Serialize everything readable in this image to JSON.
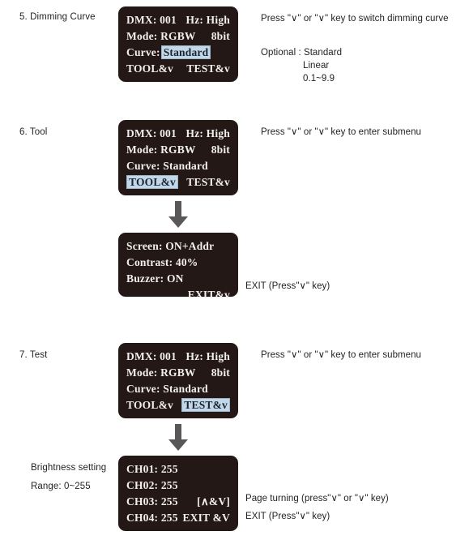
{
  "sections": [
    {
      "id": "dimming-curve",
      "label": "5. Dimming Curve",
      "lcd": {
        "row1_left": "DMX: 001",
        "row1_right": "Hz: High",
        "row2_left": "Mode: RGBW",
        "row2_right": "8bit",
        "row3_label": "Curve:",
        "row3_value": "Standard",
        "row4_left": "TOOL&v",
        "row4_right": "TEST&v"
      },
      "notes": {
        "instruction": "Press \"∨\" or \"∨\" key to switch dimming curve",
        "optional_label": "Optional : Standard",
        "optional_items": [
          "Linear",
          "0.1~9.9"
        ]
      }
    },
    {
      "id": "tool",
      "label": "6. Tool",
      "lcd": {
        "row1_left": "DMX: 001",
        "row1_right": "Hz: High",
        "row2_left": "Mode: RGBW",
        "row2_right": "8bit",
        "row3_left": "Curve: Standard",
        "row4_left": "TOOL&v",
        "row4_right": "TEST&v"
      },
      "notes": {
        "instruction": "Press \"∨\" or \"∨\" key to enter submenu"
      },
      "submenu": {
        "row1": "Screen: ON+Addr",
        "row2": "Contrast: 40%",
        "row3": "Buzzer: ON",
        "row4": "EXIT&v",
        "note": "EXIT (Press\"∨\" key)"
      }
    },
    {
      "id": "test",
      "label": "7. Test",
      "lcd": {
        "row1_left": "DMX: 001",
        "row1_right": "Hz: High",
        "row2_left": "Mode: RGBW",
        "row2_right": "8bit",
        "row3_left": "Curve: Standard",
        "row4_left": "TOOL&v",
        "row4_right": "TEST&v"
      },
      "notes": {
        "instruction": "Press \"∨\" or \"∨\" key to enter submenu"
      },
      "submenu": {
        "left_label_1": "Brightness setting",
        "left_label_2": "Range: 0~255",
        "ch1": "CH01: 255",
        "ch2": "CH02: 255",
        "ch3": "CH03: 255",
        "ch3_right": "[∧&V]",
        "ch4": "CH04: 255",
        "ch4_right": "EXIT &V",
        "note_page": "Page turning (press\"∨\" or \"∨\" key)",
        "note_exit": "EXIT (Press\"∨\" key)"
      }
    }
  ],
  "icons": {
    "arrow_down": "arrow-down-icon"
  },
  "colors": {
    "lcd_background": "#231815",
    "lcd_text": "#f2f0ee",
    "highlight_background": "#c2d8e8",
    "highlight_text": "#1b2430",
    "page_text": "#231f20",
    "arrow": "#595757"
  }
}
